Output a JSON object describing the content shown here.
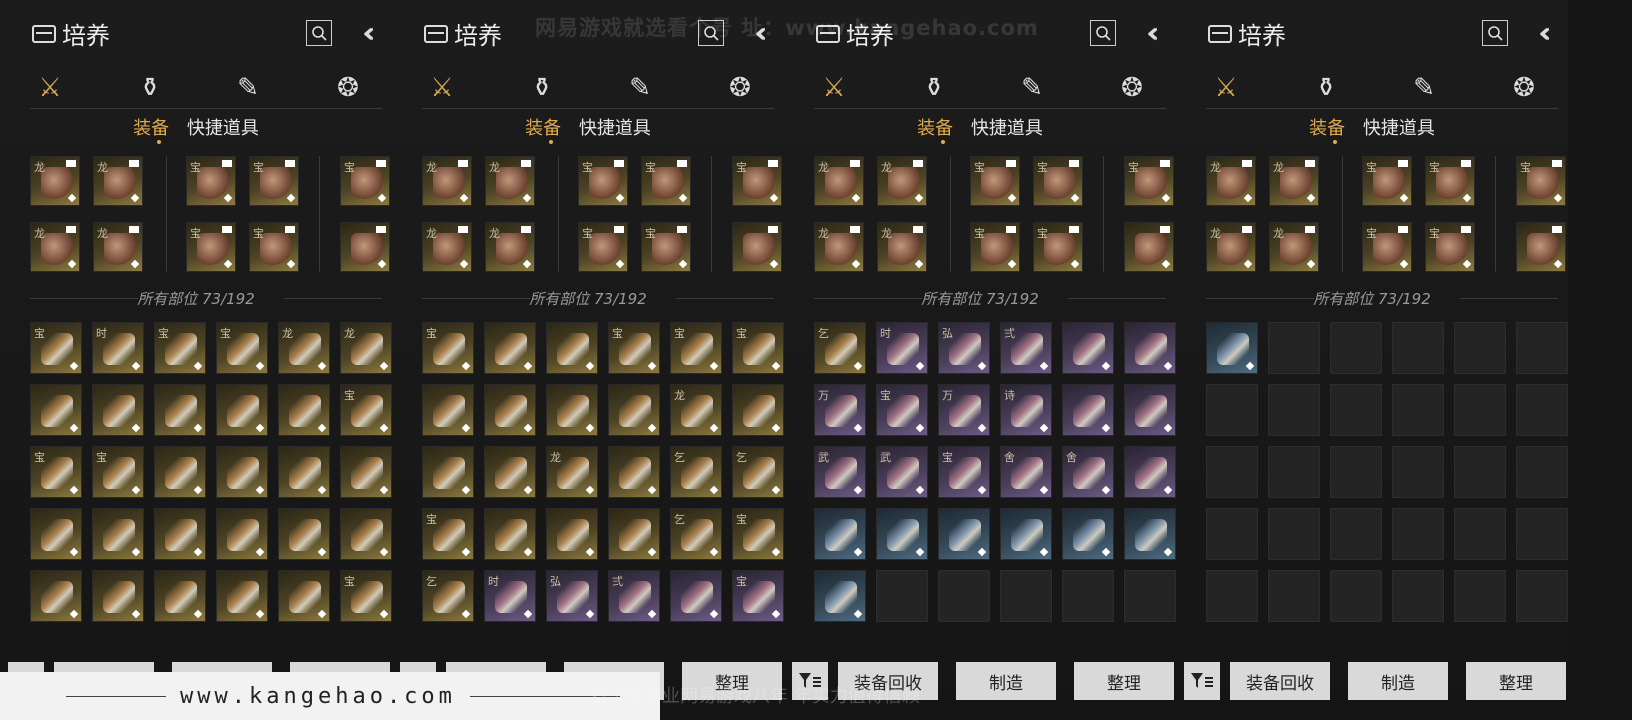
{
  "panel_title": "培养",
  "subtabs": [
    "装备",
    "快捷道具"
  ],
  "count_label": "所有部位 73/192",
  "buttons": {
    "recycle": "装备回收",
    "craft": "制造",
    "sort": "整理"
  },
  "category_icons": [
    "crossed-swords-icon",
    "pouch-icon",
    "scroll-icon",
    "token-icon"
  ],
  "watermark_top": "网易游戏就选看个号  址：www.kangehao.com",
  "watermark_bottom": "看个号专业网易游戏八年 年实力值得信赖",
  "watermark_url": "www.kangehao.com",
  "colors": {
    "accent": "#e0a94e",
    "gold_slot": "#8c7a40",
    "purple_slot": "#6d5c86",
    "blue_slot": "#4f6c82"
  },
  "equipped_tags": [
    "龙",
    "龙",
    "宝",
    "宝",
    "宝",
    "龙",
    "龙",
    "宝",
    "宝",
    ""
  ],
  "panels": [
    {
      "grid": [
        "gold",
        "gold",
        "gold",
        "gold",
        "gold",
        "gold",
        "gold",
        "gold",
        "gold",
        "gold",
        "gold",
        "gold",
        "gold",
        "gold",
        "gold",
        "gold",
        "gold",
        "gold",
        "gold",
        "gold",
        "gold",
        "gold",
        "gold",
        "gold",
        "gold",
        "gold",
        "gold",
        "gold",
        "gold",
        "gold"
      ],
      "tags": [
        "宝",
        "时",
        "宝",
        "宝",
        "龙",
        "龙",
        "",
        "",
        "",
        "",
        "",
        "宝",
        "宝",
        "宝",
        "",
        "",
        "",
        "",
        "",
        "",
        "",
        "",
        "",
        "",
        "",
        "",
        "",
        "",
        "",
        "宝"
      ]
    },
    {
      "grid": [
        "gold",
        "gold",
        "gold",
        "gold",
        "gold",
        "gold",
        "gold",
        "gold",
        "gold",
        "gold",
        "gold",
        "gold",
        "gold",
        "gold",
        "gold",
        "gold",
        "gold",
        "gold",
        "gold",
        "gold",
        "gold",
        "gold",
        "gold",
        "gold",
        "gold",
        "purple",
        "purple",
        "purple",
        "purple",
        "purple"
      ],
      "tags": [
        "宝",
        "",
        "",
        "宝",
        "宝",
        "宝",
        "",
        "",
        "",
        "",
        "龙",
        "",
        "",
        "",
        "龙",
        "",
        "乞",
        "乞",
        "宝",
        "",
        "",
        "",
        "乞",
        "宝",
        "乞",
        "时",
        "弘",
        "弍",
        "",
        "宝"
      ]
    },
    {
      "grid": [
        "gold",
        "purple",
        "purple",
        "purple",
        "purple",
        "purple",
        "purple",
        "purple",
        "purple",
        "purple",
        "purple",
        "purple",
        "purple",
        "purple",
        "purple",
        "purple",
        "purple",
        "purple",
        "blue",
        "blue",
        "blue",
        "blue",
        "blue",
        "blue",
        "blue",
        "empty",
        "empty",
        "empty",
        "empty",
        "empty"
      ],
      "tags": [
        "乞",
        "时",
        "弘",
        "弍",
        "",
        "",
        "万",
        "宝",
        "万",
        "诗",
        "",
        "",
        "武",
        "武",
        "宝",
        "舍",
        "舍",
        "",
        "",
        "",
        "",
        "",
        "",
        "",
        "",
        "",
        "",
        "",
        "",
        ""
      ]
    },
    {
      "grid": [
        "blue",
        "empty",
        "empty",
        "empty",
        "empty",
        "empty",
        "empty",
        "empty",
        "empty",
        "empty",
        "empty",
        "empty",
        "empty",
        "empty",
        "empty",
        "empty",
        "empty",
        "empty",
        "empty",
        "empty",
        "empty",
        "empty",
        "empty",
        "empty",
        "empty",
        "empty",
        "empty",
        "empty",
        "empty",
        "empty"
      ],
      "tags": [
        "",
        "",
        "",
        "",
        "",
        "",
        "",
        "",
        "",
        "",
        "",
        "",
        "",
        "",
        "",
        "",
        "",
        "",
        "",
        "",
        "",
        "",
        "",
        "",
        "",
        "",
        "",
        "",
        "",
        ""
      ]
    }
  ]
}
